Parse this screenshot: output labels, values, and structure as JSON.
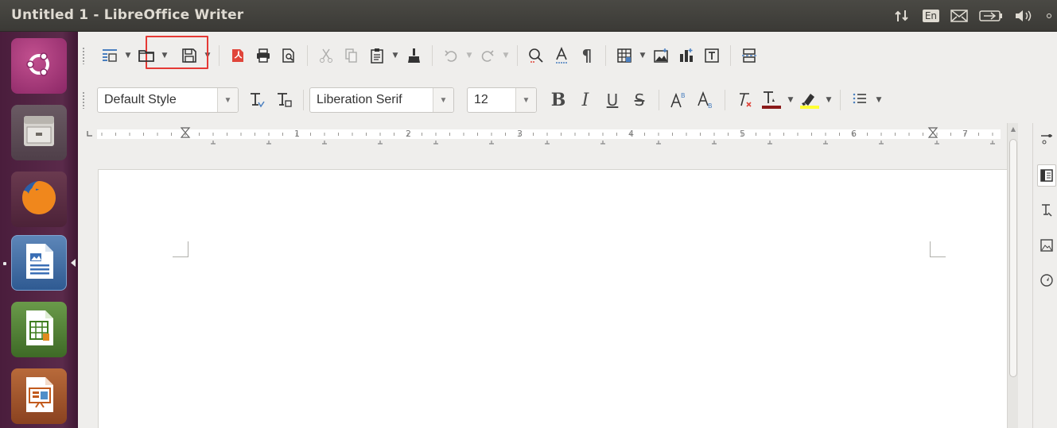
{
  "window": {
    "title": "Untitled 1 - LibreOffice Writer"
  },
  "tray": {
    "network_icon": "network-updown-icon",
    "language": "En",
    "mail_icon": "mail-icon",
    "battery_icon": "battery-icon",
    "volume_icon": "volume-icon"
  },
  "launcher": {
    "items": [
      {
        "name": "ubuntu-dash",
        "icon": "ubuntu-logo-icon"
      },
      {
        "name": "files",
        "icon": "file-cabinet-icon"
      },
      {
        "name": "firefox",
        "icon": "firefox-icon"
      },
      {
        "name": "libreoffice-writer",
        "icon": "writer-icon",
        "active": true
      },
      {
        "name": "libreoffice-calc",
        "icon": "calc-icon"
      },
      {
        "name": "libreoffice-impress",
        "icon": "impress-icon"
      }
    ]
  },
  "standard_toolbar": {
    "items": [
      "new-document",
      "open-document",
      "save-document",
      "export-pdf",
      "print",
      "print-preview",
      "cut",
      "copy",
      "paste",
      "clone-formatting",
      "undo",
      "redo",
      "find-replace",
      "spelling",
      "formatting-marks",
      "insert-table",
      "insert-image",
      "insert-chart",
      "insert-textbox",
      "insert-page-break"
    ],
    "highlighted": "open-document"
  },
  "formatting_toolbar": {
    "paragraph_style": "Default Style",
    "font_name": "Liberation Serif",
    "font_size": "12",
    "buttons": [
      "update-style",
      "new-style",
      "bold",
      "italic",
      "underline",
      "strikethrough",
      "superscript",
      "subscript",
      "clear-formatting",
      "font-color",
      "highlight-color",
      "list"
    ],
    "font_color": "#8b1a1a",
    "highlight_color": "#ffff33"
  },
  "ruler": {
    "labels": [
      "1",
      "2",
      "3",
      "4",
      "5",
      "6",
      "7"
    ]
  },
  "sidebar": {
    "items": [
      "properties",
      "styles",
      "gallery",
      "navigator"
    ]
  },
  "colors": {
    "launcher": "#4a1d3c",
    "accent_highlight": "#e53935"
  }
}
